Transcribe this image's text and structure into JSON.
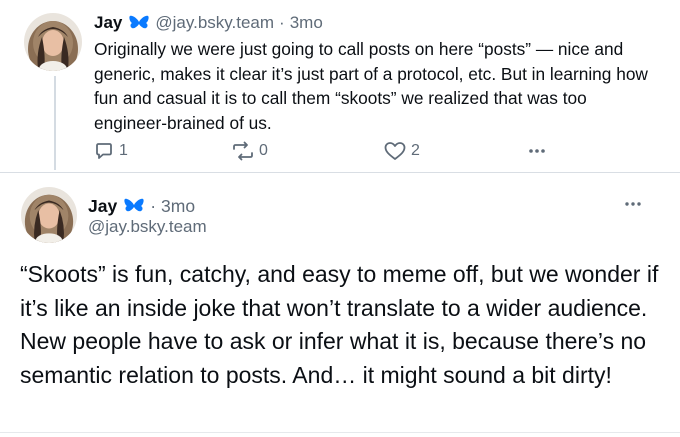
{
  "posts": [
    {
      "author": "Jay",
      "handle": "@jay.bsky.team",
      "time": "3mo",
      "text": "Originally we were just going to call posts on here “posts” — nice and generic, makes it clear it’s just part of a protocol, etc. But in learning how fun and casual it is to call them “skoots” we realized that was too engineer-brained of us.",
      "replies": "1",
      "reposts": "0",
      "likes": "2"
    },
    {
      "author": "Jay",
      "handle": "@jay.bsky.team",
      "time": "3mo",
      "text": "“Skoots” is fun, catchy, and easy to meme off, but we wonder if it’s like an inside joke that won’t translate to a wider audience. New people have to ask or infer what it is, because there’s no semantic relation to posts. And… it might sound a bit dirty!"
    }
  ],
  "icons": {
    "verified": "butterfly-icon",
    "reply": "reply-icon",
    "repost": "repost-icon",
    "like": "heart-icon",
    "more": "more-icon"
  },
  "colors": {
    "text": "#0b0f14",
    "muted": "#5f6b78",
    "accent": "#0a7aff",
    "divider": "#d9dee4"
  }
}
